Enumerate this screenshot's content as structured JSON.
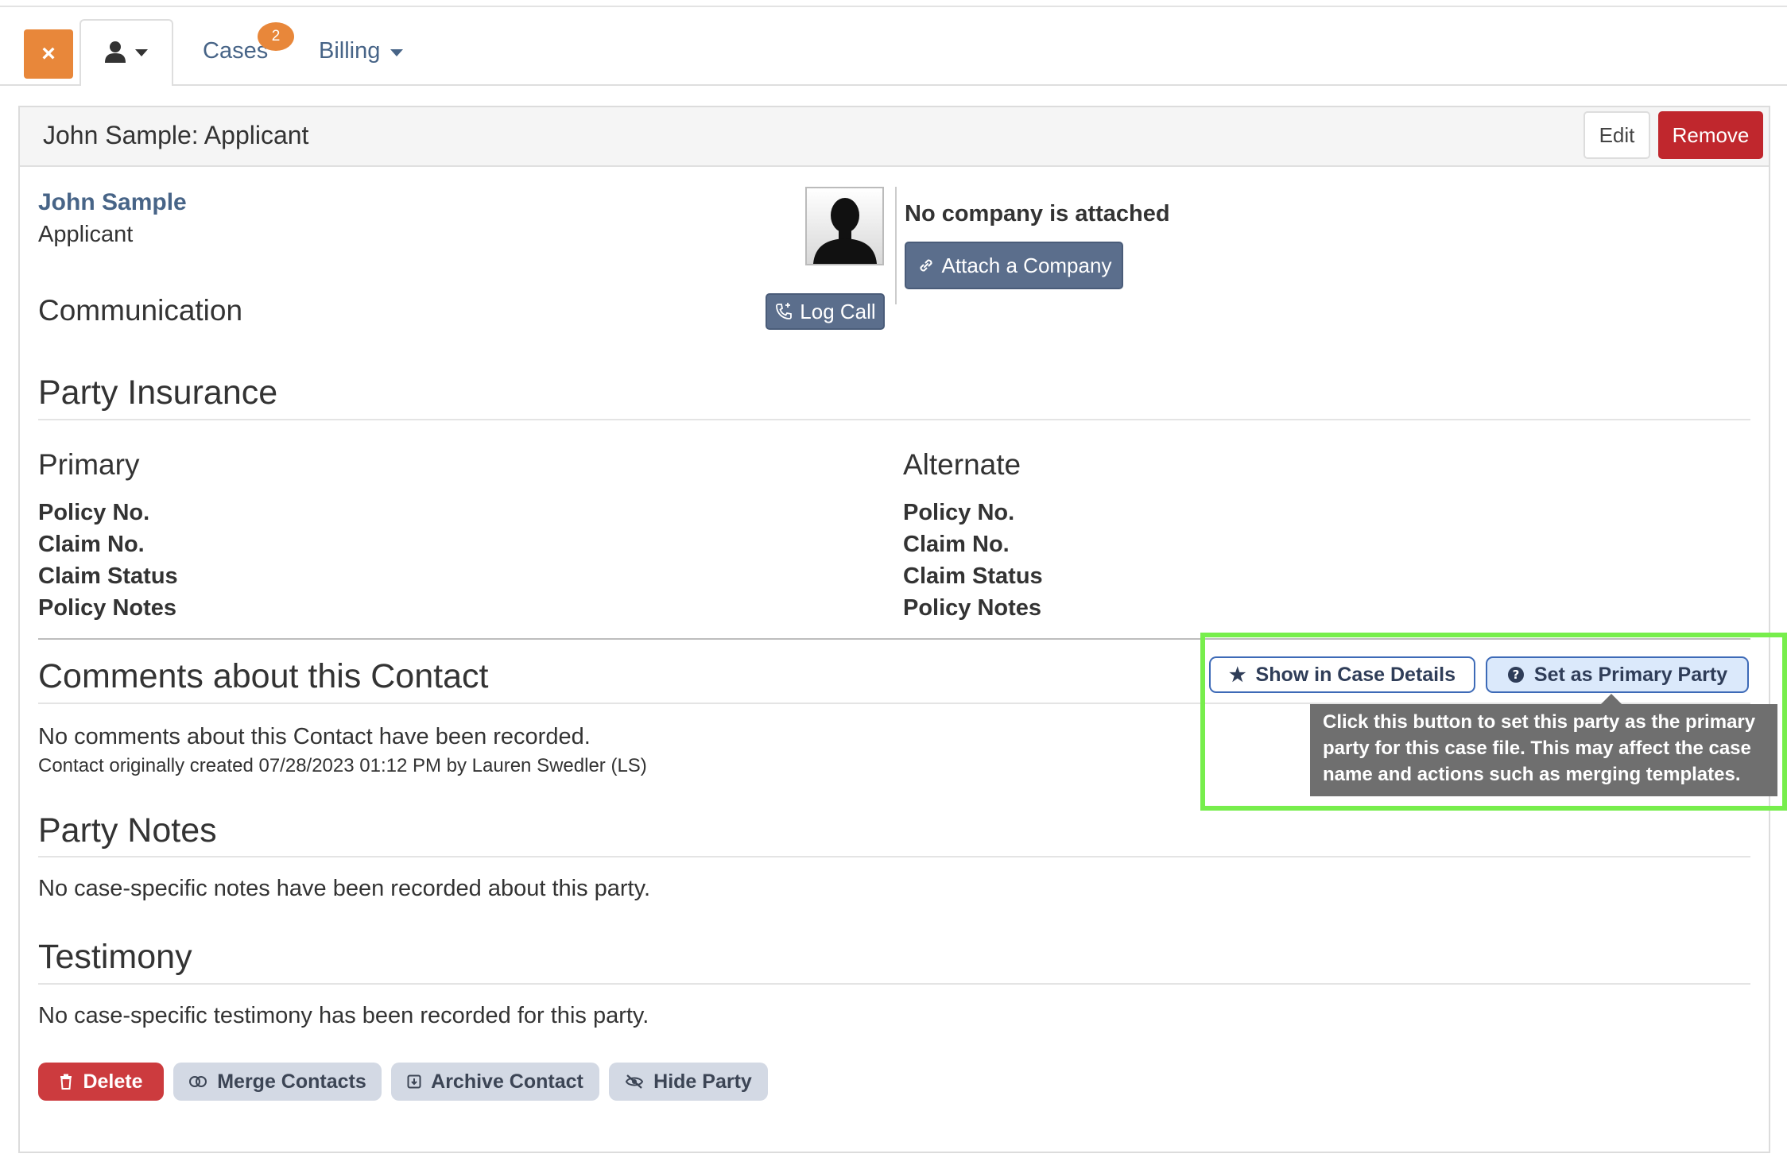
{
  "tabs": {
    "close_label": "×",
    "cases_label": "Cases",
    "cases_badge": "2",
    "billing_label": "Billing"
  },
  "panel": {
    "title": "John Sample: Applicant",
    "edit_label": "Edit",
    "remove_label": "Remove"
  },
  "contact": {
    "name": "John Sample",
    "role": "Applicant",
    "communication_heading": "Communication",
    "log_call_label": "Log Call",
    "company_status": "No company is attached",
    "attach_company_label": "Attach a Company"
  },
  "insurance": {
    "heading": "Party Insurance",
    "primary": {
      "heading": "Primary",
      "fields": [
        "Policy No.",
        "Claim No.",
        "Claim Status",
        "Policy Notes"
      ]
    },
    "alternate": {
      "heading": "Alternate",
      "fields": [
        "Policy No.",
        "Claim No.",
        "Claim Status",
        "Policy Notes"
      ]
    }
  },
  "comments": {
    "heading": "Comments about this Contact",
    "empty_text": "No comments about this Contact have been recorded.",
    "created_text": "Contact originally created 07/28/2023 01:12 PM by Lauren Swedler (LS)",
    "show_in_case_label": "Show in Case Details",
    "set_primary_label": "Set as Primary Party",
    "tooltip": "Click this button to set this party as the primary party for this case file. This may affect the case name and actions such as merging templates.",
    "highlight_color": "#77ee4c"
  },
  "party_notes": {
    "heading": "Party Notes",
    "empty_text": "No case-specific notes have been recorded about this party."
  },
  "testimony": {
    "heading": "Testimony",
    "empty_text": "No case-specific testimony has been recorded for this party."
  },
  "actions": {
    "delete_label": "Delete",
    "merge_label": "Merge Contacts",
    "archive_label": "Archive Contact",
    "hide_label": "Hide Party"
  },
  "colors": {
    "accent_orange": "#e8873a",
    "danger_red": "#c0272d",
    "link_blue": "#476487",
    "slate_button": "#5b6e8c"
  }
}
